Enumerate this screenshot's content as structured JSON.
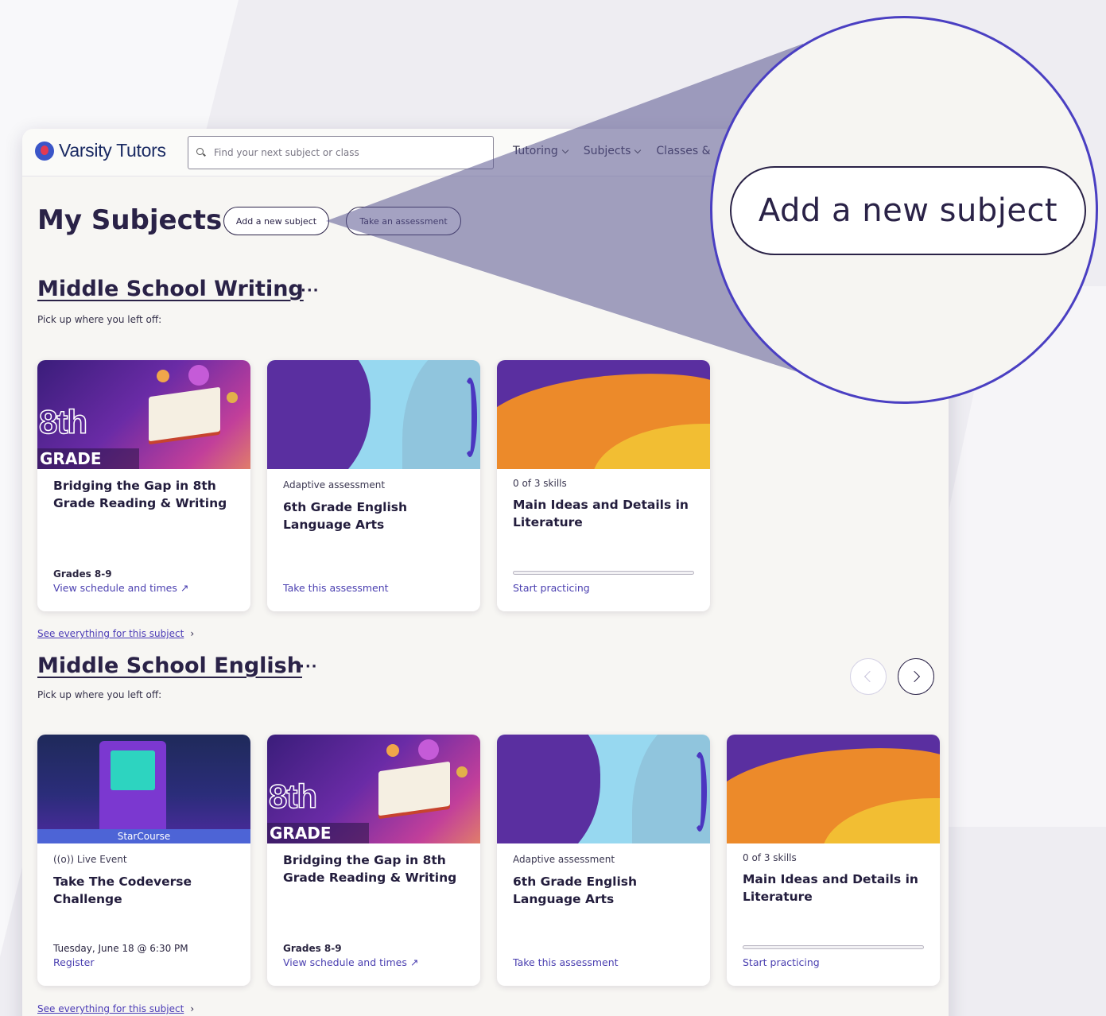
{
  "header": {
    "logo_text": "Varsity Tutors",
    "search_placeholder": "Find your next subject or class",
    "nav": [
      "Tutoring",
      "Subjects",
      "Classes &"
    ]
  },
  "page": {
    "title": "My Subjects",
    "add_subject_label": "Add a new subject",
    "take_assessment_label": "Take an assessment"
  },
  "zoom_callout": {
    "label": "Add a new subject"
  },
  "sections": [
    {
      "title": "Middle School Writing",
      "more": "···",
      "subtext": "Pick up where you left off:",
      "see_all": "See everything for this subject",
      "cards": [
        {
          "image": "8th-grade-book",
          "image_text": "8th",
          "image_banner": "GRADE",
          "title": "Bridging the Gap in 8th Grade Reading & Writing",
          "meta": "Grades 8-9",
          "link": "View schedule and times ↗"
        },
        {
          "image": "purple-blue-wave",
          "kicker": "Adaptive assessment",
          "title": "6th Grade English Language Arts",
          "link": "Take this assessment"
        },
        {
          "image": "purple-orange-sunset",
          "kicker": "0 of 3 skills",
          "title": "Main Ideas and Details in Literature",
          "progress": 0,
          "link": "Start practicing"
        }
      ]
    },
    {
      "title": "Middle School English",
      "more": "···",
      "subtext": "Pick up where you left off:",
      "see_all": "See everything for this subject",
      "cards": [
        {
          "image": "arcade-starcourse",
          "image_banner": "StarCourse",
          "kicker": "((o)) Live Event",
          "title": "Take The Codeverse Challenge",
          "meta": "Tuesday, June 18 @ 6:30 PM",
          "link": "Register"
        },
        {
          "image": "8th-grade-book",
          "image_text": "8th",
          "image_banner": "GRADE",
          "title": "Bridging the Gap in 8th Grade Reading & Writing",
          "meta": "Grades 8-9",
          "link": "View schedule and times ↗"
        },
        {
          "image": "purple-blue-wave",
          "kicker": "Adaptive assessment",
          "title": "6th Grade English Language Arts",
          "link": "Take this assessment"
        },
        {
          "image": "purple-orange-sunset",
          "kicker": "0 of 3 skills",
          "title": "Main Ideas and Details in Literature",
          "progress": 0,
          "link": "Start practicing"
        }
      ]
    }
  ],
  "colors": {
    "brand": "#2a2247",
    "link": "#4a3fb0",
    "callout": "#4a3fc2"
  }
}
